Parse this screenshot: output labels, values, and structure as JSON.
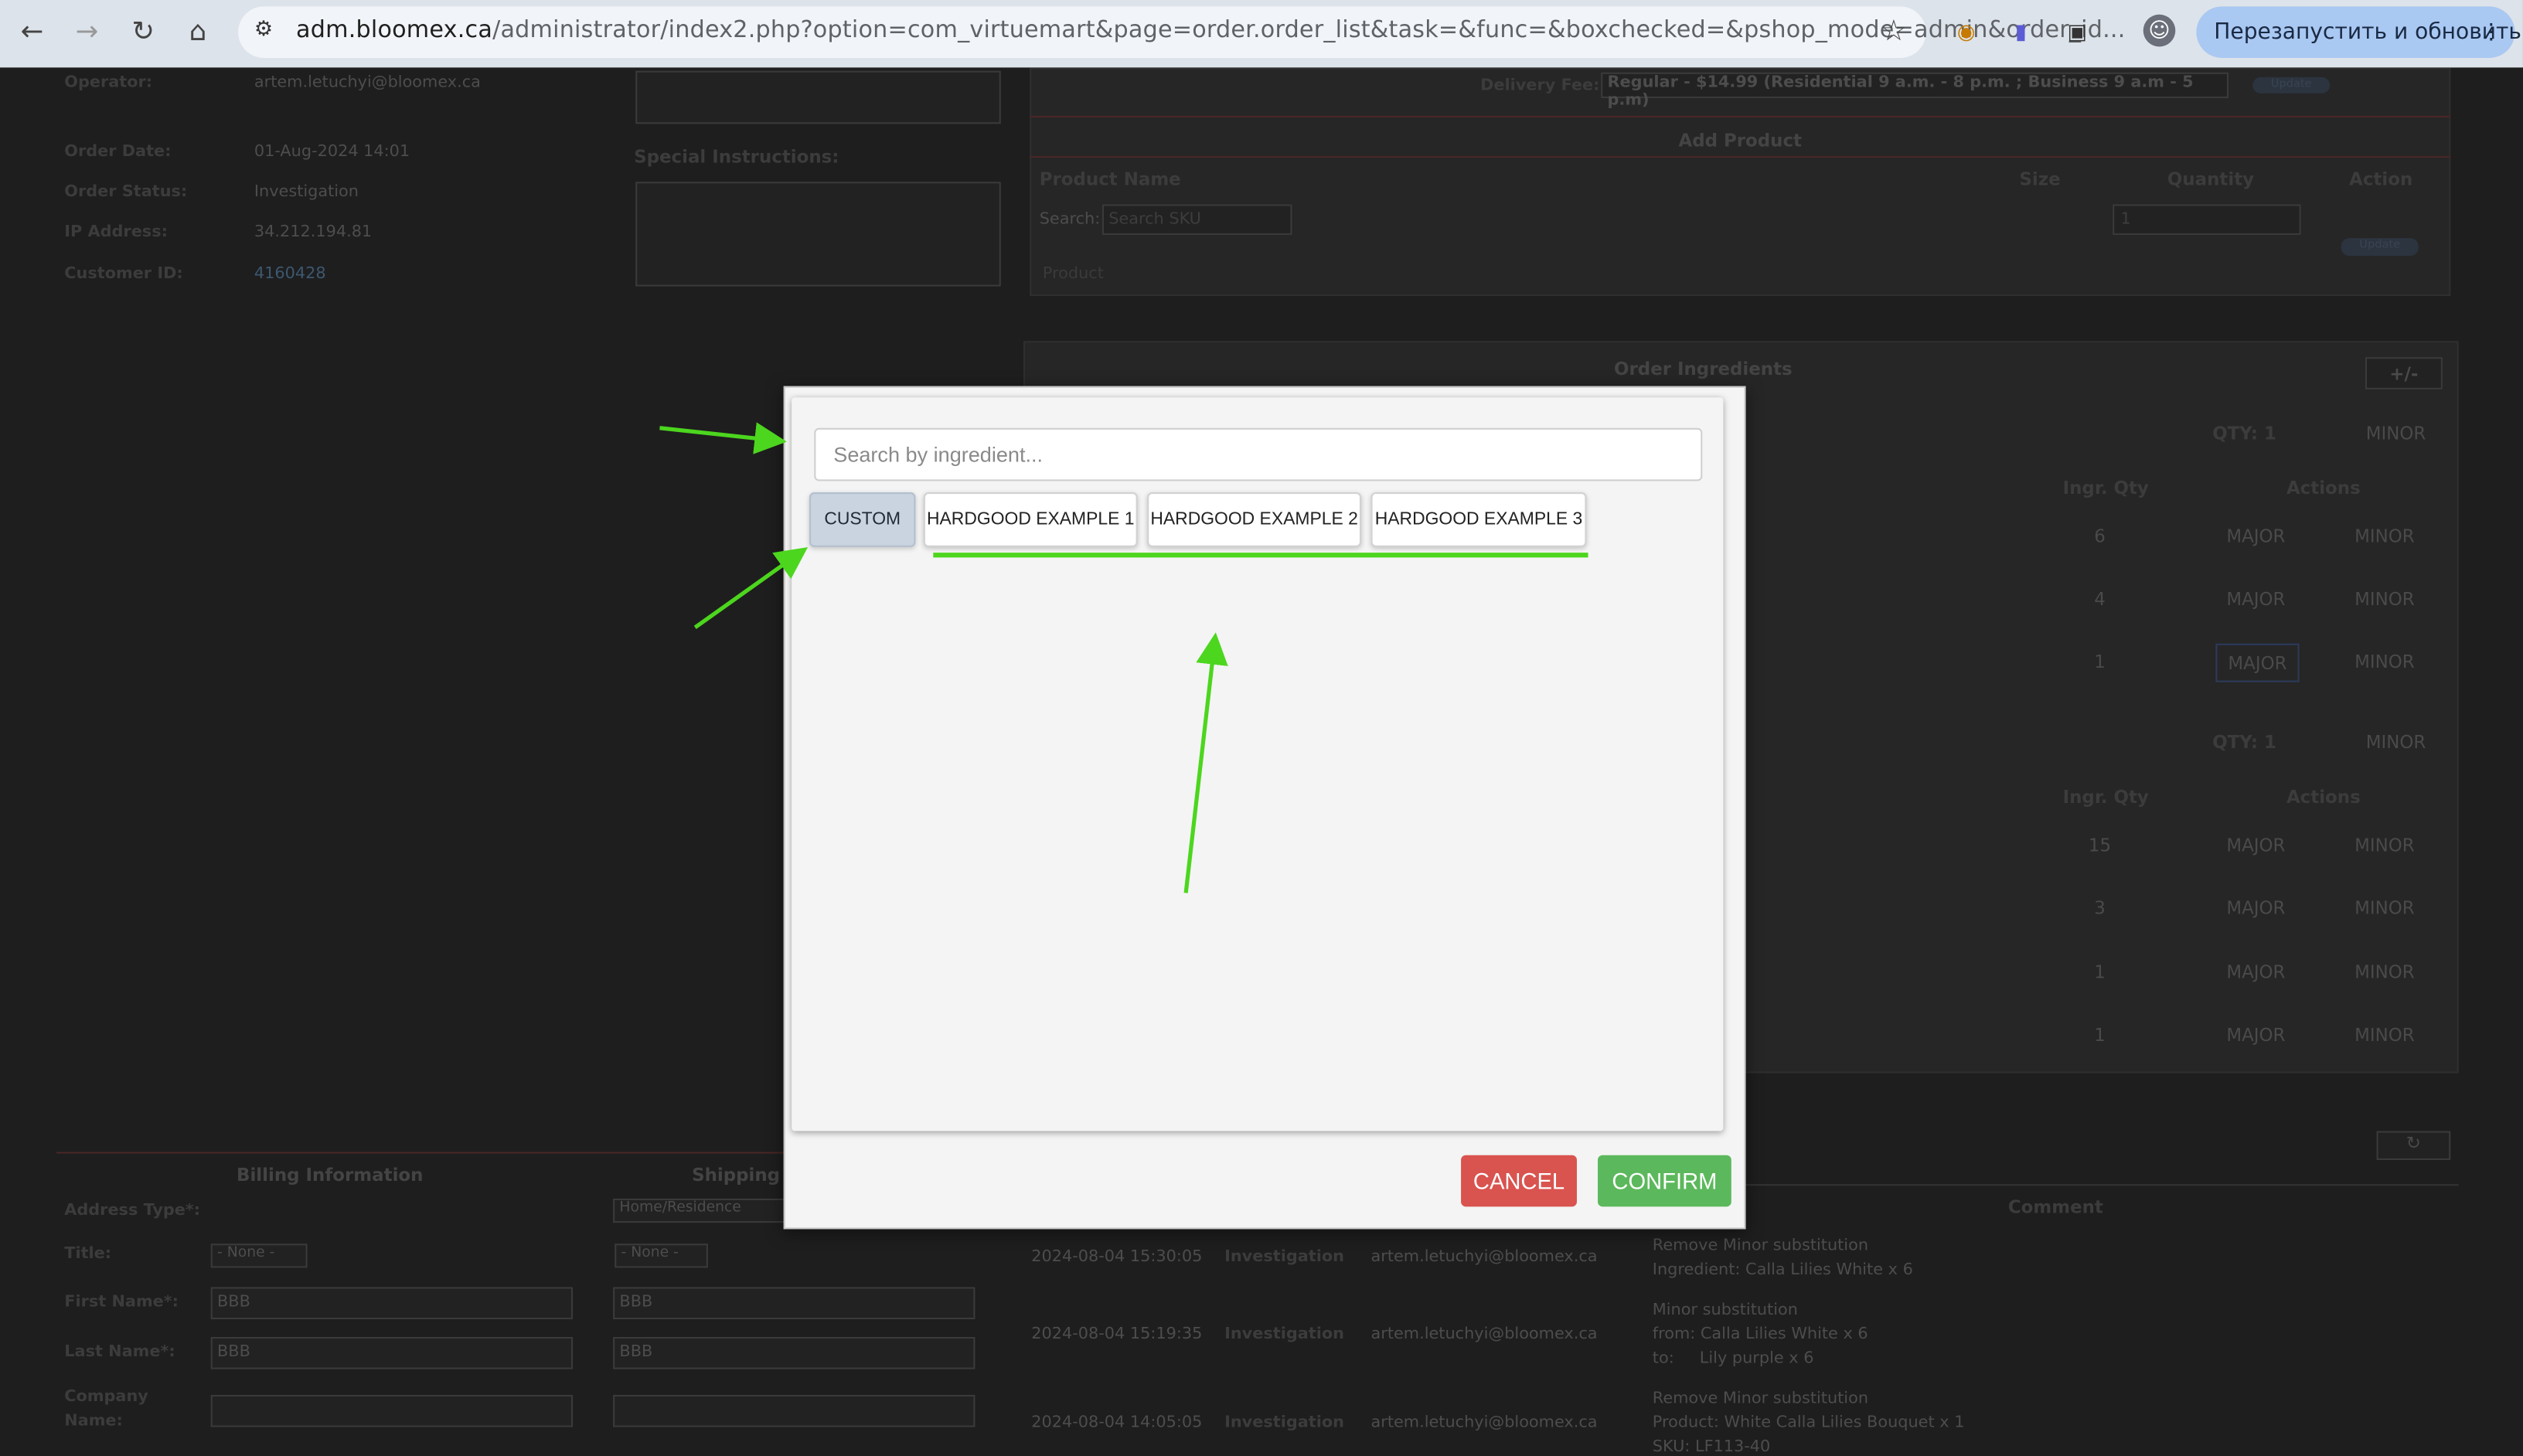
{
  "browser": {
    "url_host": "adm.bloomex.ca",
    "url_path": "/administrator/index2.php?option=com_virtuemart&page=order.order_list&task=&func=&boxchecked=&pshop_mode=admin&order_id...",
    "relaunch_label": "Перезапустить и обновить",
    "icons": [
      "back-icon",
      "forward-icon",
      "reload-icon",
      "home-icon",
      "tune-icon",
      "star-icon",
      "extension-icon",
      "profile-icon",
      "menu-icon"
    ]
  },
  "order": {
    "operator_label": "Operator:",
    "operator_value": "artem.letuchyi@bloomex.ca",
    "date_label": "Order Date:",
    "date_value": "01-Aug-2024 14:01",
    "status_label": "Order Status:",
    "status_value": "Investigation",
    "ip_label": "IP Address:",
    "ip_value": "34.212.194.81",
    "customer_label": "Customer ID:",
    "customer_value": "4160428",
    "special_label": "Special Instructions:"
  },
  "delivery": {
    "fee_label": "Delivery Fee:",
    "fee_value": "Regular - $14.99 (Residential 9 a.m. - 8 p.m. ; Business 9 a.m - 5 p.m)",
    "update_label": "Update"
  },
  "add_product": {
    "title": "Add Product",
    "col_name": "Product Name",
    "col_size": "Size",
    "col_qty": "Quantity",
    "col_action": "Action",
    "search_label": "Search:",
    "search_placeholder": "Search SKU",
    "qty_value": "1",
    "update_label": "Update",
    "product_label": "Product"
  },
  "ingredients": {
    "title": "Order Ingredients",
    "toggle": "+/-",
    "group1_qty": "QTY: 1",
    "group2_qty": "QTY: 1",
    "minor": "MINOR",
    "major": "MAJOR",
    "col_qty": "Ingr. Qty",
    "col_actions": "Actions",
    "group1_rows": [
      "6",
      "4",
      "1"
    ],
    "group2_rows": [
      "15",
      "3",
      "1",
      "1"
    ]
  },
  "history": {
    "comment_header": "Comment",
    "rows": [
      {
        "date": "2024-08-04 15:30:05",
        "status": "Investigation",
        "user": "artem.letuchyi@bloomex.ca",
        "comment": "Remove Minor substitution",
        "comment2": "Ingredient: Calla Lilies White x 6",
        "comment3": ""
      },
      {
        "date": "2024-08-04 15:19:35",
        "status": "Investigation",
        "user": "artem.letuchyi@bloomex.ca",
        "comment": "Minor substitution",
        "comment2": "from: Calla Lilies White x 6",
        "comment3": "to:     Lily purple x 6"
      },
      {
        "date": "2024-08-04 14:05:05",
        "status": "Investigation",
        "user": "artem.letuchyi@bloomex.ca",
        "comment": "Remove Minor substitution",
        "comment2": "Product: White Calla Lilies Bouquet x 1",
        "comment3": "SKU: LF113-40"
      }
    ]
  },
  "billing": {
    "title": "Billing Information",
    "shipping_title": "Shipping",
    "address_type_label": "Address Type*:",
    "address_type_value": "Home/Residence",
    "title_label": "Title:",
    "title_value": "- None -",
    "first_label": "First Name*:",
    "first_value": "BBB",
    "last_label": "Last Name*:",
    "last_value": "BBB",
    "company_label": "Company",
    "company_label2": "Name:"
  },
  "modal": {
    "search_placeholder": "Search by ingredient...",
    "chips": [
      "CUSTOM",
      "HARDGOOD EXAMPLE 1",
      "HARDGOOD EXAMPLE 2",
      "HARDGOOD EXAMPLE 3"
    ],
    "cancel_label": "CANCEL",
    "confirm_label": "CONFIRM",
    "colors": {
      "cancel": "#d9534f",
      "confirm": "#5cb85c",
      "active_chip": "#c9d4e0",
      "annotation": "#4cd61e"
    }
  }
}
